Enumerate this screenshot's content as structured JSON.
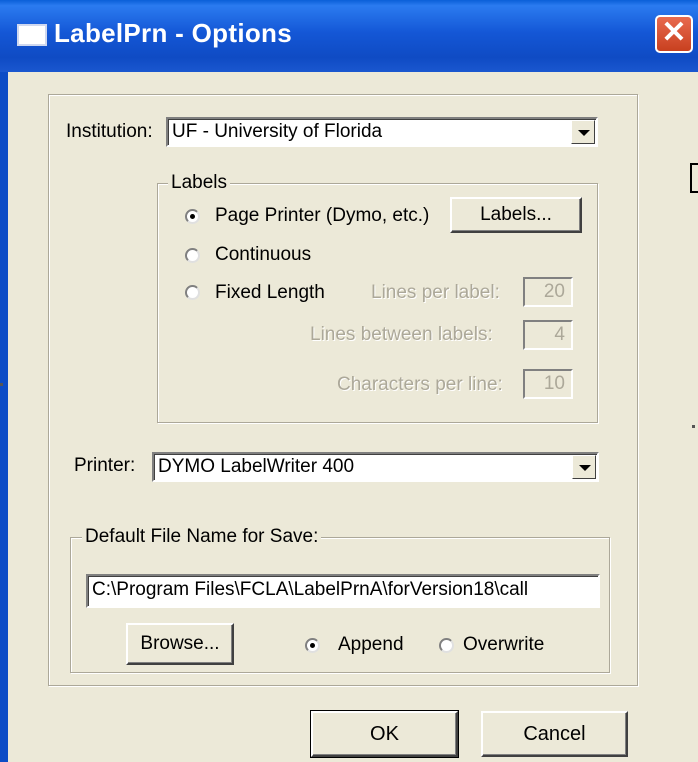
{
  "window": {
    "title": "LabelPrn - Options"
  },
  "institution": {
    "label": "Institution:",
    "value": "UF - University of Florida"
  },
  "labels_group": {
    "title": "Labels",
    "options": [
      {
        "label": "Page Printer (Dymo, etc.)",
        "selected": true
      },
      {
        "label": "Continuous",
        "selected": false
      },
      {
        "label": "Fixed Length",
        "selected": false
      }
    ],
    "labels_button": "Labels...",
    "lines_per_label": {
      "label": "Lines per label:",
      "value": "20"
    },
    "lines_between_labels": {
      "label": "Lines between labels:",
      "value": "4"
    },
    "characters_per_line": {
      "label": "Characters per line:",
      "value": "10"
    }
  },
  "printer": {
    "label": "Printer:",
    "value": "DYMO LabelWriter 400"
  },
  "save_group": {
    "title": "Default File Name for Save:",
    "path": "C:\\Program Files\\FCLA\\LabelPrnA\\forVersion18\\call",
    "browse_button": "Browse...",
    "append_label": "Append",
    "overwrite_label": "Overwrite",
    "mode": "Append"
  },
  "footer": {
    "ok_label": "OK",
    "cancel_label": "Cancel"
  },
  "colors": {
    "titlebar": "#0f4bc4",
    "dialog_bg": "#ece9d8",
    "close_button": "#d9532f",
    "disabled_text": "#aca899"
  },
  "icons": {
    "window_icon": "window-icon",
    "close": "close-icon"
  }
}
